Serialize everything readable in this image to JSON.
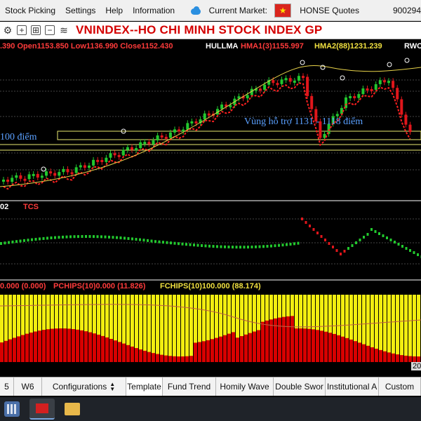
{
  "menu": {
    "items": [
      "Stock Picking",
      "Settings",
      "Help",
      "Information"
    ],
    "market_label": "Current Market:",
    "market_name": "HONSE Quotes",
    "account_number": "900294",
    "flag_symbol": "★"
  },
  "toolbar": {
    "icons": [
      "gear-icon",
      "add-icon",
      "add-window-icon",
      "remove-icon",
      "layers-icon"
    ],
    "title": "VNINDEX--HO CHI MINH STOCK INDEX  GP"
  },
  "chart": {
    "ohlc_text": ".390 Open1153.850 Low1136.990 Close1152.430",
    "indicator_name": "HULLMA",
    "hma1_text": "HMA1(3)1155.997",
    "hma2_text": "HMA2(88)1231.239",
    "rwc_text": "RWC",
    "support_label": "Vùng hỗ trợ 1131 - 1118 điểm",
    "left_zone_label": "100 điểm",
    "panel2_id": "02",
    "panel2_name": "TCS",
    "panel3_text_1": "0.000 (0.000)",
    "panel3_text_2": "PCHIPS(10)0.000 (11.826)",
    "panel3_text_3": "FCHIPS(10)100.000 (88.174)",
    "corner_tag": "20",
    "colors": {
      "up": "#22c82e",
      "down": "#e0161b",
      "hma_red": "#ff2020",
      "hma_yellow": "#e8d34a",
      "fchips_yellow": "#f2ee10",
      "pchips_red": "#d80000",
      "support_blue": "#5aa0ff"
    }
  },
  "tabs": {
    "items": [
      "5",
      "W6",
      "Configurations",
      "Template",
      "Fund Trend",
      "Homily Wave",
      "Double Swor",
      "Institutional A",
      "Custom"
    ],
    "active": "Template"
  },
  "taskbar": {
    "icons": [
      "calculator-icon",
      "stock-app-icon",
      "folder-icon"
    ]
  }
}
